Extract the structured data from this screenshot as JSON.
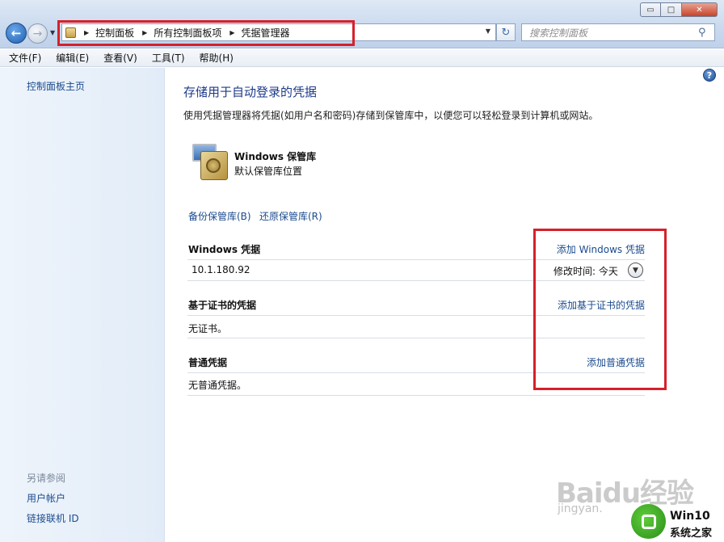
{
  "window": {
    "buttons": {
      "minimize": "▭",
      "maximize": "□",
      "close": "✕"
    }
  },
  "address": {
    "crumbs": [
      "控制面板",
      "所有控制面板项",
      "凭据管理器"
    ],
    "dropdown_icon": "chevron-down-icon"
  },
  "search": {
    "placeholder": "搜索控制面板"
  },
  "menu": {
    "items": [
      "文件(F)",
      "编辑(E)",
      "查看(V)",
      "工具(T)",
      "帮助(H)"
    ]
  },
  "left": {
    "home": "控制面板主页",
    "see_also": "另请参阅",
    "links": [
      "用户帐户",
      "链接联机 ID"
    ]
  },
  "main": {
    "title": "存储用于自动登录的凭据",
    "description": "使用凭据管理器将凭据(如用户名和密码)存储到保管库中，以便您可以轻松登录到计算机或网站。",
    "vault": {
      "name": "Windows 保管库",
      "subtitle": "默认保管库位置"
    },
    "backup_link": "备份保管库(B)",
    "restore_link": "还原保管库(R)",
    "sections": [
      {
        "heading": "Windows 凭据",
        "add_link": "添加 Windows 凭据",
        "items": [
          {
            "name": "10.1.180.92",
            "modified": "修改时间:  今天"
          }
        ]
      },
      {
        "heading": "基于证书的凭据",
        "add_link": "添加基于证书的凭据",
        "empty": "无证书。"
      },
      {
        "heading": "普通凭据",
        "add_link": "添加普通凭据",
        "empty": "无普通凭据。"
      }
    ]
  },
  "watermark": {
    "baidu": "Baidu经验",
    "jingyan": "jingyan.",
    "win10": "Win10",
    "site": "系统之家"
  },
  "colors": {
    "highlight": "#d6202a",
    "link": "#1b4b8e",
    "title": "#1e3b8a"
  }
}
